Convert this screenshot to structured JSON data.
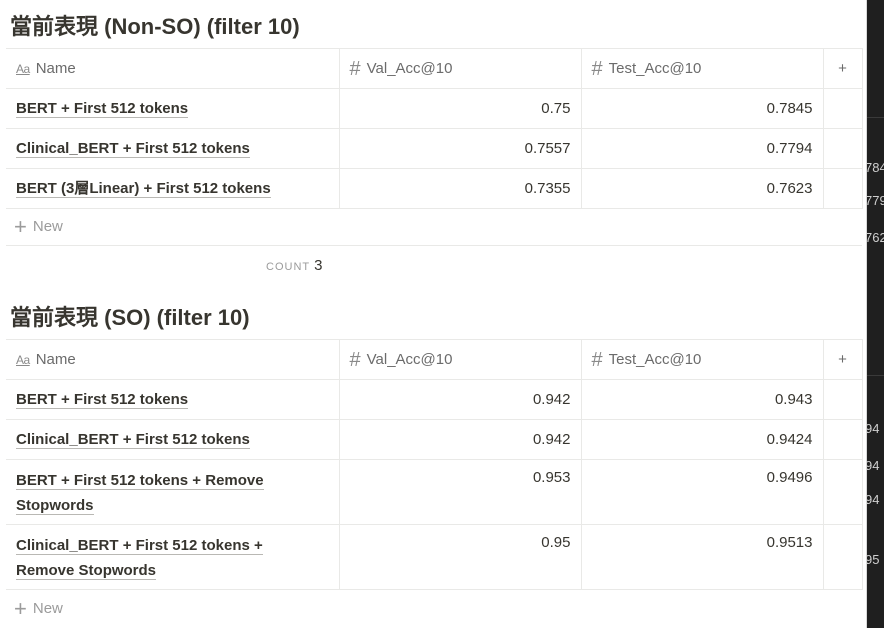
{
  "tables": [
    {
      "title": "當前表現 (Non-SO) (filter 10)",
      "columns": {
        "name": "Name",
        "val": "Val_Acc@10",
        "test": "Test_Acc@10"
      },
      "rows": [
        {
          "name": "BERT + First 512 tokens",
          "val": "0.75",
          "test": "0.7845"
        },
        {
          "name": "Clinical_BERT + First 512 tokens",
          "val": "0.7557",
          "test": "0.7794"
        },
        {
          "name": "BERT (3層Linear) + First 512 tokens",
          "val": "0.7355",
          "test": "0.7623"
        }
      ],
      "new_label": "New",
      "count_label": "COUNT",
      "count_value": "3"
    },
    {
      "title": "當前表現 (SO) (filter 10)",
      "columns": {
        "name": "Name",
        "val": "Val_Acc@10",
        "test": "Test_Acc@10"
      },
      "rows": [
        {
          "name": "BERT + First 512 tokens",
          "val": "0.942",
          "test": "0.943"
        },
        {
          "name": "Clinical_BERT + First 512 tokens",
          "val": "0.942",
          "test": "0.9424"
        },
        {
          "name_line1": "BERT + First 512 tokens + Remove",
          "name_line2": "Stopwords",
          "val": "0.953",
          "test": "0.9496"
        },
        {
          "name_line1": "Clinical_BERT + First 512 tokens +",
          "name_line2": "Remove Stopwords",
          "val": "0.95",
          "test": "0.9513"
        }
      ],
      "new_label": "New"
    }
  ],
  "add_column_glyph": "+",
  "icons": {
    "title_icon": "Aa",
    "number_icon": "#",
    "plus_icon": "+"
  },
  "background_fragments": [
    "784",
    "779",
    "762",
    "94",
    "94",
    "94",
    "95"
  ]
}
